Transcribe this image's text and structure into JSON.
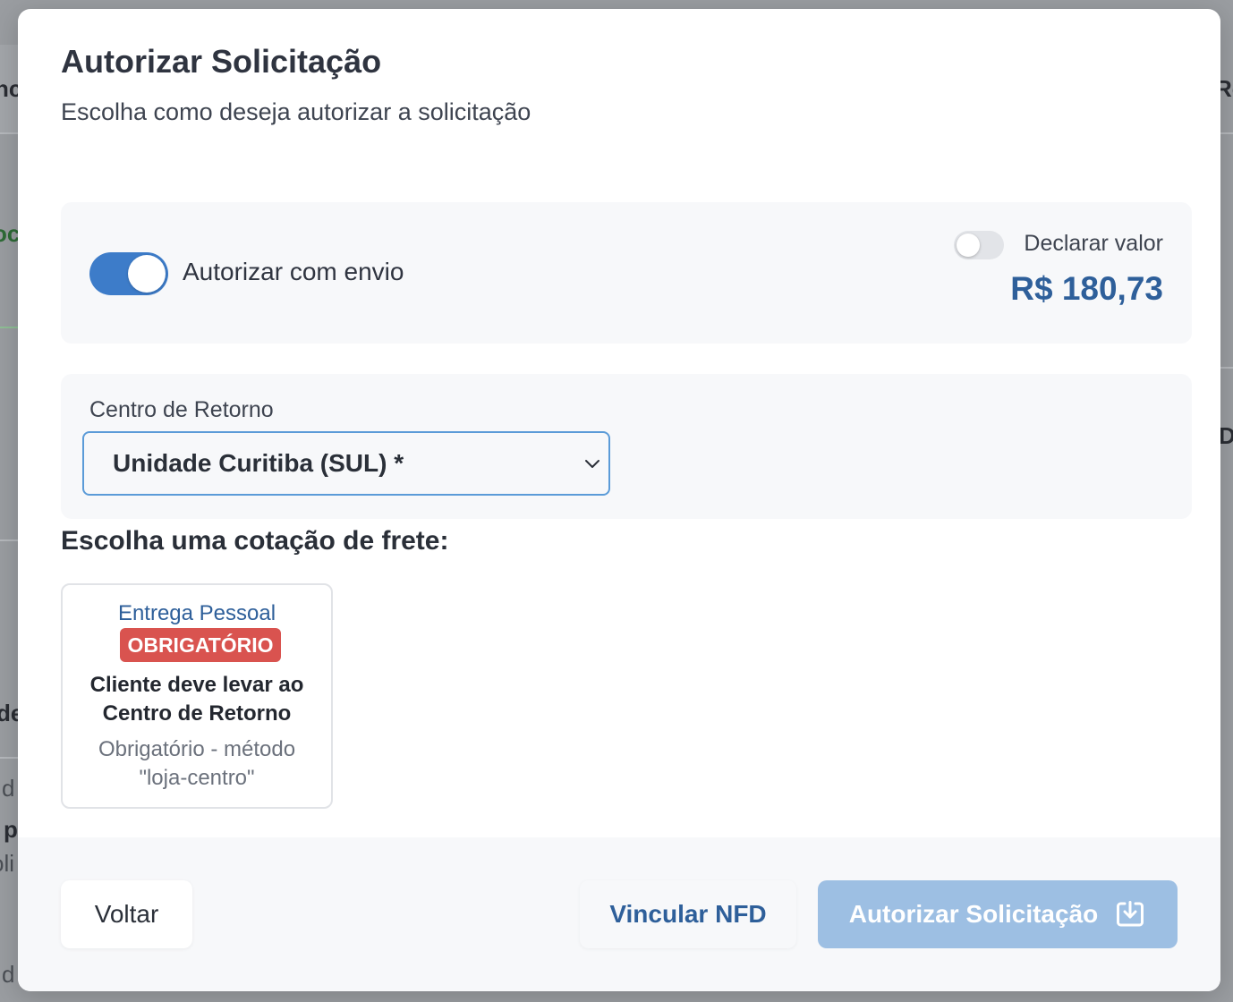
{
  "background": {
    "fragments": [
      "nc",
      "Re",
      "oc",
      "D",
      "de",
      "d",
      "p",
      "oli",
      "d"
    ]
  },
  "modal": {
    "title": "Autorizar Solicitação",
    "subtitle": "Escolha como deseja autorizar a solicitação"
  },
  "authorization": {
    "with_shipping_label": "Autorizar com envio",
    "with_shipping_enabled": true,
    "declare_value_label": "Declarar valor",
    "declare_value_enabled": false,
    "amount": "R$ 180,73"
  },
  "return_center": {
    "label": "Centro de Retorno",
    "selected": "Unidade Curitiba (SUL) *"
  },
  "freight": {
    "heading": "Escolha uma cotação de frete:",
    "quotes": [
      {
        "carrier": "Entrega Pessoal",
        "badge": "OBRIGATÓRIO",
        "description": "Cliente deve levar ao Centro de Retorno",
        "note": "Obrigatório - método \"loja-centro\""
      }
    ]
  },
  "footer": {
    "back_label": "Voltar",
    "link_nfd_label": "Vincular NFD",
    "authorize_label": "Autorizar Solicitação"
  },
  "colors": {
    "accent": "#3d7cc9",
    "amount": "#2e5f9a",
    "badge": "#d9534f",
    "authorize_button_disabled": "#9dbfe3"
  },
  "icons": {
    "select": "chevron-down-icon",
    "authorize": "download-tray-icon"
  }
}
